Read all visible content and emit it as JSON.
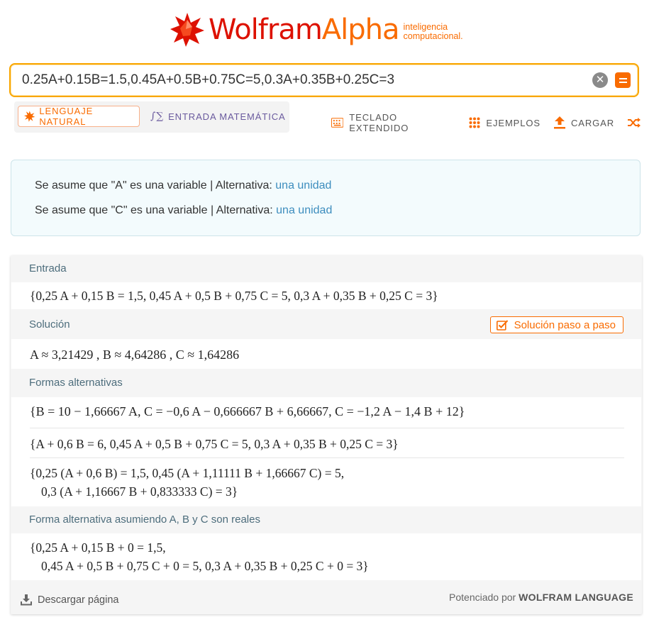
{
  "header": {
    "logo_word_1": "Wolfram",
    "logo_word_2": "Alpha",
    "tagline_1": "inteligencia",
    "tagline_2": "computacional."
  },
  "search": {
    "value": "0.25A+0.15B=1.5,0.45A+0.5B+0.75C=5,0.3A+0.35B+0.25C=3"
  },
  "modes": {
    "natural_label": "LENGUAJE NATURAL",
    "math_label": "ENTRADA MATEMÁTICA"
  },
  "tools": [
    {
      "label": "TECLADO EXTENDIDO",
      "icon": "keyboard-icon"
    },
    {
      "label": "EJEMPLOS",
      "icon": "dots-grid-icon"
    },
    {
      "label": "CARGAR",
      "icon": "upload-icon"
    },
    {
      "label": "",
      "icon": "shuffle-icon"
    }
  ],
  "assumptions": [
    {
      "text": "Se asume que \"A\" es una variable | Alternativa: ",
      "link": "una unidad"
    },
    {
      "text": "Se asume que \"C\" es una variable | Alternativa: ",
      "link": "una unidad"
    }
  ],
  "pods": {
    "input": {
      "title": "Entrada",
      "expr": "{0,25 A + 0,15 B = 1,5, 0,45 A + 0,5 B + 0,75 C = 5, 0,3 A + 0,35 B + 0,25 C = 3}"
    },
    "solution": {
      "title": "Solución",
      "step_button": "Solución paso a paso",
      "expr": "A ≈ 3,21429 ,    B ≈ 4,64286 ,    C ≈ 1,64286"
    },
    "alt_forms": {
      "title": "Formas alternativas",
      "forms": [
        "{B = 10 − 1,66667 A, C = −0,6 A − 0,666667 B + 6,66667, C = −1,2 A − 1,4 B + 12}",
        "{A + 0,6 B = 6, 0,45 A + 0,5 B + 0,75 C = 5, 0,3 A + 0,35 B + 0,25 C = 3}",
        "{0,25 (A + 0,6 B) = 1,5, 0,45 (A + 1,11111 B + 1,66667 C) = 5,",
        "0,3 (A + 1,16667 B + 0,833333 C) = 3}"
      ]
    },
    "alt_real": {
      "title": "Forma alternativa asumiendo A, B y C son reales",
      "line_1": "{0,25 A + 0,15 B + 0 = 1,5,",
      "line_2": "0,45 A + 0,5 B + 0,75 C + 0 = 5, 0,3 A + 0,35 B + 0,25 C + 0 = 3}"
    }
  },
  "footer": {
    "download": "Descargar página",
    "powered_prefix": "Potenciado por ",
    "powered_brand": "WOLFRAM LANGUAGE"
  },
  "colors": {
    "accent_orange": "#f96b00",
    "brand_red": "#dd1100",
    "search_border": "#f9a600",
    "link_blue": "#3d8dbe",
    "pod_title": "#4d6d7c"
  }
}
